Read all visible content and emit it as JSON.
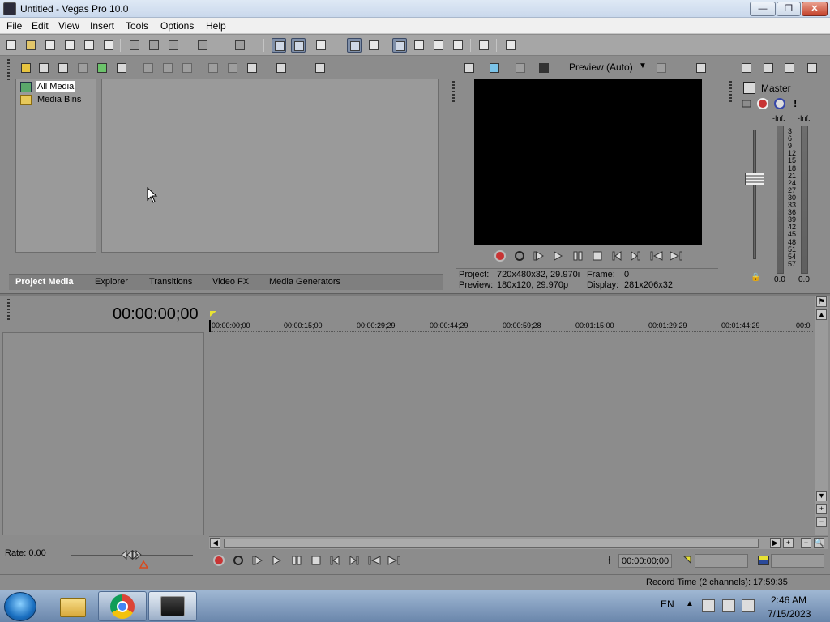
{
  "window": {
    "title": "Untitled - Vegas Pro 10.0",
    "min": "—",
    "max": "❐",
    "close": "✕"
  },
  "menu": [
    "File",
    "Edit",
    "View",
    "Insert",
    "Tools",
    "Options",
    "Help"
  ],
  "explorer": {
    "tree": [
      "All Media",
      "Media Bins"
    ],
    "tabs": [
      "Project Media",
      "Explorer",
      "Transitions",
      "Video FX",
      "Media Generators"
    ]
  },
  "preview": {
    "quality": "Preview (Auto)",
    "project_label": "Project:",
    "project_value": "720x480x32, 29.970i",
    "frame_label": "Frame:",
    "frame_value": "0",
    "preview_label": "Preview:",
    "preview_value": "180x120, 29.970p",
    "display_label": "Display:",
    "display_value": "281x206x32"
  },
  "master": {
    "label": "Master",
    "peak_left": "-Inf.",
    "peak_right": "-Inf.",
    "scale": [
      "3",
      "6",
      "9",
      "12",
      "15",
      "18",
      "21",
      "24",
      "27",
      "30",
      "33",
      "36",
      "39",
      "42",
      "45",
      "48",
      "51",
      "54",
      "57"
    ],
    "value_left": "0.0",
    "value_right": "0.0"
  },
  "timeline": {
    "timecode": "00:00:00;00",
    "ruler": [
      "00:00:00;00",
      "00:00:15;00",
      "00:00:29;29",
      "00:00:44;29",
      "00:00:59;28",
      "00:01:15;00",
      "00:01:29;29",
      "00:01:44;29",
      "00:0"
    ],
    "rate": "Rate: 0.00",
    "cursor_time": "00:00:00;00"
  },
  "status": {
    "record_time": "Record Time (2 channels): 17:59:35"
  },
  "taskbar": {
    "lang": "EN",
    "time": "2:46 AM",
    "date": "7/15/2023"
  }
}
